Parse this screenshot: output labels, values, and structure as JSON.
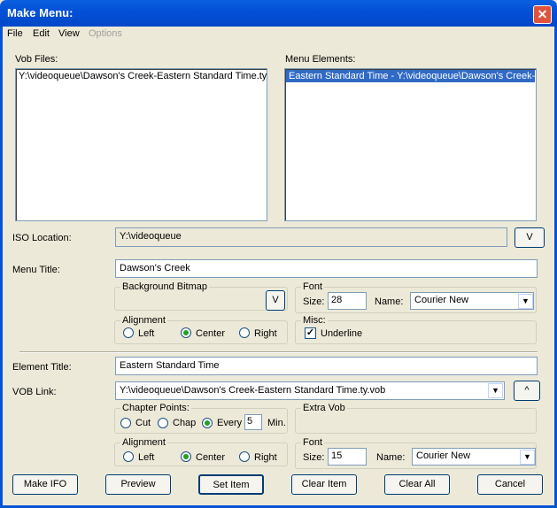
{
  "window": {
    "title": "Make Menu:",
    "close_symbol": "✕"
  },
  "menu": {
    "file": "File",
    "edit": "Edit",
    "view": "View",
    "options": "Options"
  },
  "vob_files": {
    "label": "Vob Files:",
    "items": [
      "Y:\\videoqueue\\Dawson's Creek-Eastern Standard Time.ty."
    ]
  },
  "menu_elements": {
    "label": "Menu Elements:",
    "items": [
      "Eastern Standard Time - Y:\\videoqueue\\Dawson's Creek-E"
    ]
  },
  "iso": {
    "label": "ISO Location:",
    "value": "Y:\\videoqueue",
    "button": "V"
  },
  "menu_title": {
    "label": "Menu Title:",
    "value": "Dawson's Creek"
  },
  "background": {
    "legend": "Background Bitmap",
    "button": "V"
  },
  "font1": {
    "legend": "Font",
    "size_label": "Size:",
    "size": "28",
    "name_label": "Name:",
    "name": "Courier New"
  },
  "alignment1": {
    "legend": "Alignment",
    "left": "Left",
    "center": "Center",
    "right": "Right",
    "selected": "center"
  },
  "misc": {
    "legend": "Misc:",
    "underline": "Underline",
    "checked": true
  },
  "element_title": {
    "label": "Element Title:",
    "value": "Eastern Standard Time"
  },
  "vob_link": {
    "label": "VOB Link:",
    "value": "Y:\\videoqueue\\Dawson's Creek-Eastern Standard Time.ty.vob",
    "button": "^"
  },
  "chapter_points": {
    "legend": "Chapter Points:",
    "cut": "Cut",
    "chap": "Chap",
    "every": "Every",
    "every_value": "5",
    "min": "Min.",
    "selected": "every"
  },
  "extra_vob": {
    "legend": "Extra Vob"
  },
  "alignment2": {
    "legend": "Alignment",
    "left": "Left",
    "center": "Center",
    "right": "Right",
    "selected": "center"
  },
  "font2": {
    "legend": "Font",
    "size_label": "Size:",
    "size": "15",
    "name_label": "Name:",
    "name": "Courier New"
  },
  "buttons": {
    "make_ifo": "Make IFO",
    "preview": "Preview",
    "set_item": "Set Item",
    "clear_item": "Clear Item",
    "clear_all": "Clear All",
    "cancel": "Cancel"
  }
}
